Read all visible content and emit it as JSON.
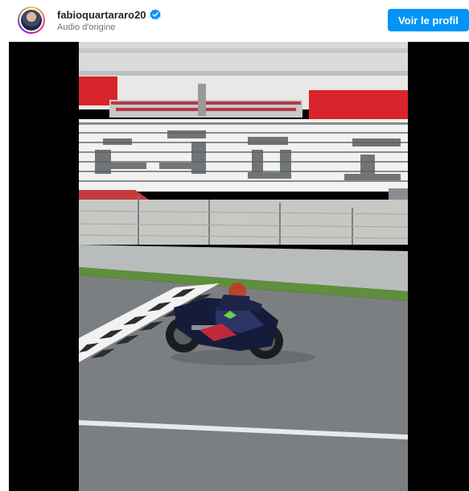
{
  "post_header": {
    "username": "fabioquartararo20",
    "audio_label": "Audio d'origine",
    "profile_button_label": "Voir le profil"
  },
  "colors": {
    "accent": "#0095f6",
    "verified": "#0095f6",
    "player_background": "#000000"
  },
  "icons": {
    "verified": "verified-badge-icon",
    "avatar": "profile-avatar"
  },
  "video": {
    "description": "MotoGP rider on motorcycle crossing the checkered start line in front of a grandstand"
  }
}
